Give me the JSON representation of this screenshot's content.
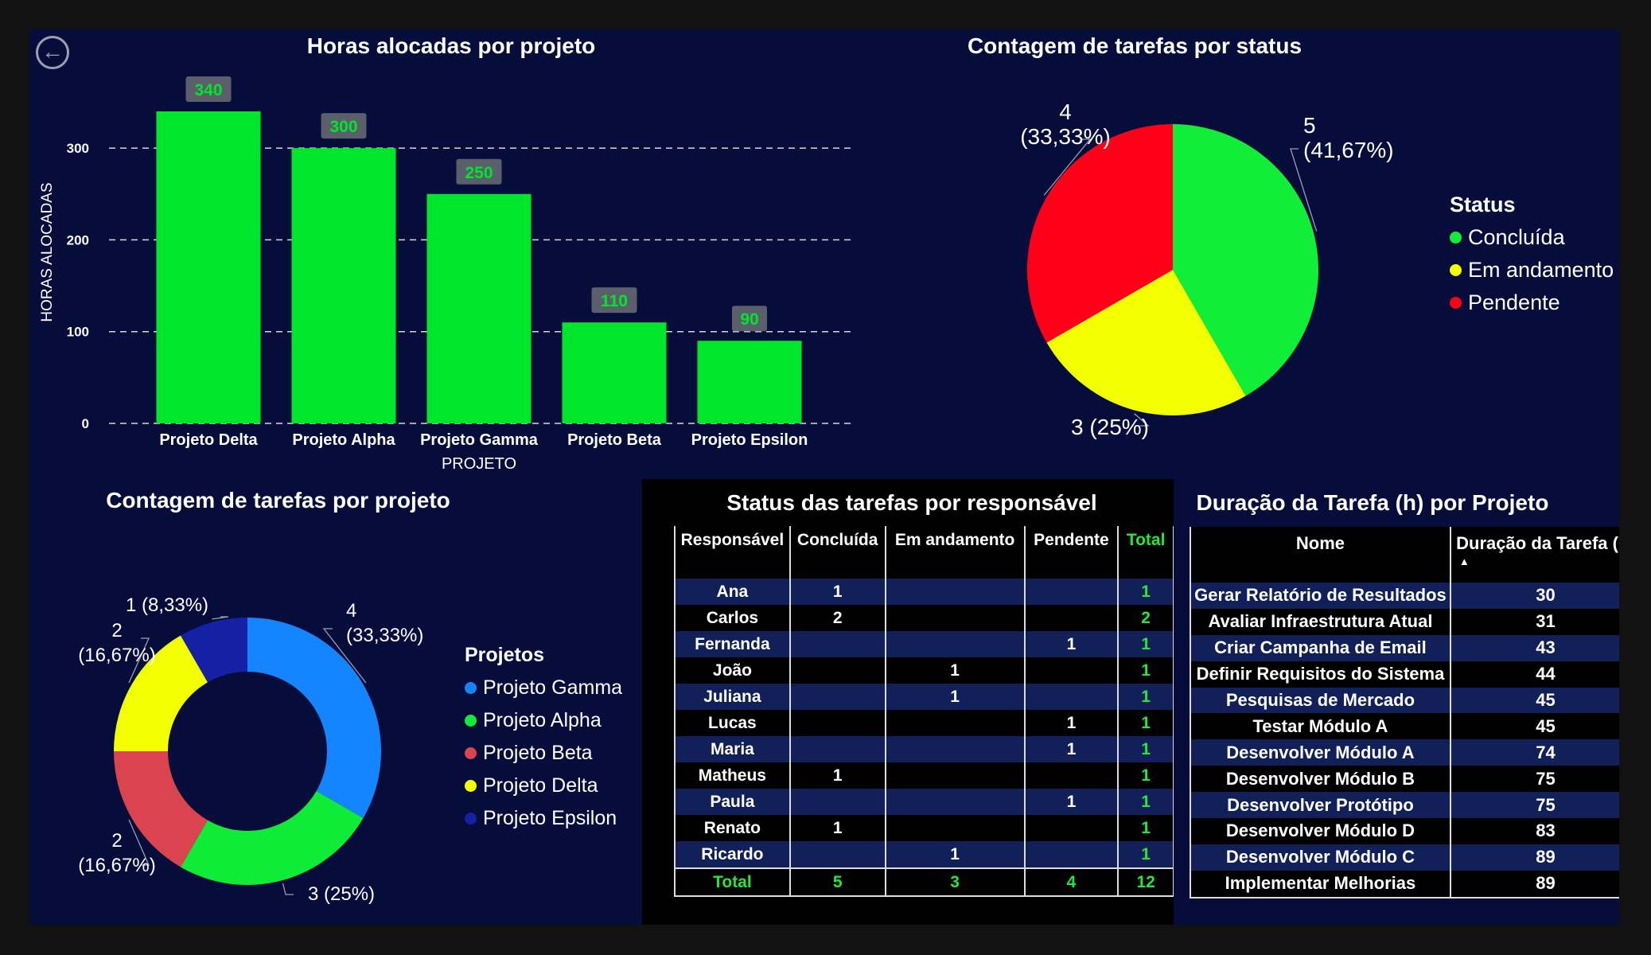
{
  "bar_chart": {
    "title": "Horas alocadas por projeto",
    "chart_data": {
      "type": "bar",
      "categories": [
        "Projeto Delta",
        "Projeto Alpha",
        "Projeto Gamma",
        "Projeto Beta",
        "Projeto Epsilon"
      ],
      "values": [
        340,
        300,
        250,
        110,
        90
      ],
      "data_labels": [
        "340",
        "300",
        "250",
        "110",
        "90"
      ],
      "title": "Horas alocadas por projeto",
      "xlabel": "PROJETO",
      "ylabel": "HORAS ALOCADAS",
      "ylim": [
        0,
        390
      ],
      "yticks": [
        0,
        100,
        200,
        300
      ],
      "ytick_labels": [
        "0",
        "100",
        "200",
        "300"
      ],
      "grid": true,
      "bar_color": "#00e62a",
      "label_color": "#00e62a",
      "label_bg": "#5b5f6c"
    }
  },
  "pie_chart": {
    "title": "Contagem de tarefas por status",
    "chart_data": {
      "type": "pie",
      "title": "Contagem de tarefas por status",
      "categories": [
        "Concluída",
        "Em andamento",
        "Pendente"
      ],
      "values": [
        5,
        3,
        4
      ],
      "labels": [
        [
          "5",
          "(41,67%)"
        ],
        [
          "3 (25%)"
        ],
        [
          "4",
          "(33,33%)"
        ]
      ],
      "colors": [
        "#10ee38",
        "#f2ff00",
        "#ff0018"
      ],
      "legend_title": "Status",
      "legend_position": "right"
    }
  },
  "donut_chart": {
    "title": "Contagem de tarefas por projeto",
    "chart_data": {
      "type": "pie",
      "title": "Contagem de tarefas por projeto",
      "categories": [
        "Projeto Gamma",
        "Projeto Alpha",
        "Projeto Beta",
        "Projeto Delta",
        "Projeto Epsilon"
      ],
      "values": [
        4,
        3,
        2,
        2,
        1
      ],
      "labels": [
        [
          "4",
          "(33,33%)"
        ],
        [
          "3 (25%)"
        ],
        [
          "2",
          "(16,67%)"
        ],
        [
          "2",
          "(16,67%)"
        ],
        [
          "1 (8,33%)"
        ]
      ],
      "colors": [
        "#1484ff",
        "#0fec38",
        "#d9444f",
        "#f2ff00",
        "#1521a5"
      ],
      "legend_title": "Projetos",
      "legend_position": "right"
    }
  },
  "status_table": {
    "title": "Status das tarefas por responsável",
    "columns": [
      "Responsável",
      "Concluída",
      "Em andamento",
      "Pendente",
      "Total"
    ],
    "rows": [
      [
        "Ana",
        "1",
        "",
        "",
        "1"
      ],
      [
        "Carlos",
        "2",
        "",
        "",
        "2"
      ],
      [
        "Fernanda",
        "",
        "",
        "1",
        "1"
      ],
      [
        "João",
        "",
        "1",
        "",
        "1"
      ],
      [
        "Juliana",
        "",
        "1",
        "",
        "1"
      ],
      [
        "Lucas",
        "",
        "",
        "1",
        "1"
      ],
      [
        "Maria",
        "",
        "",
        "1",
        "1"
      ],
      [
        "Matheus",
        "1",
        "",
        "",
        "1"
      ],
      [
        "Paula",
        "",
        "",
        "1",
        "1"
      ],
      [
        "Renato",
        "1",
        "",
        "",
        "1"
      ],
      [
        "Ricardo",
        "",
        "1",
        "",
        "1"
      ]
    ],
    "total_row": [
      "Total",
      "5",
      "3",
      "4",
      "12"
    ]
  },
  "duration_table": {
    "title": "Duração da Tarefa (h) por Projeto",
    "columns": [
      "Nome",
      "Duração da Tarefa (h)"
    ],
    "sort_indicator": "▲",
    "rows": [
      [
        "Gerar Relatório de Resultados",
        "30"
      ],
      [
        "Avaliar Infraestrutura Atual",
        "31"
      ],
      [
        "Criar Campanha de Email",
        "43"
      ],
      [
        "Definir Requisitos do Sistema",
        "44"
      ],
      [
        "Pesquisas de Mercado",
        "45"
      ],
      [
        "Testar Módulo A",
        "45"
      ],
      [
        "Desenvolver Módulo A",
        "74"
      ],
      [
        "Desenvolver Módulo B",
        "75"
      ],
      [
        "Desenvolver Protótipo",
        "75"
      ],
      [
        "Desenvolver Módulo D",
        "83"
      ],
      [
        "Desenvolver Módulo C",
        "89"
      ],
      [
        "Implementar Melhorias",
        "89"
      ]
    ]
  },
  "nav": {
    "back_icon": "arrow-left-circle-icon",
    "back_glyph": "←"
  }
}
